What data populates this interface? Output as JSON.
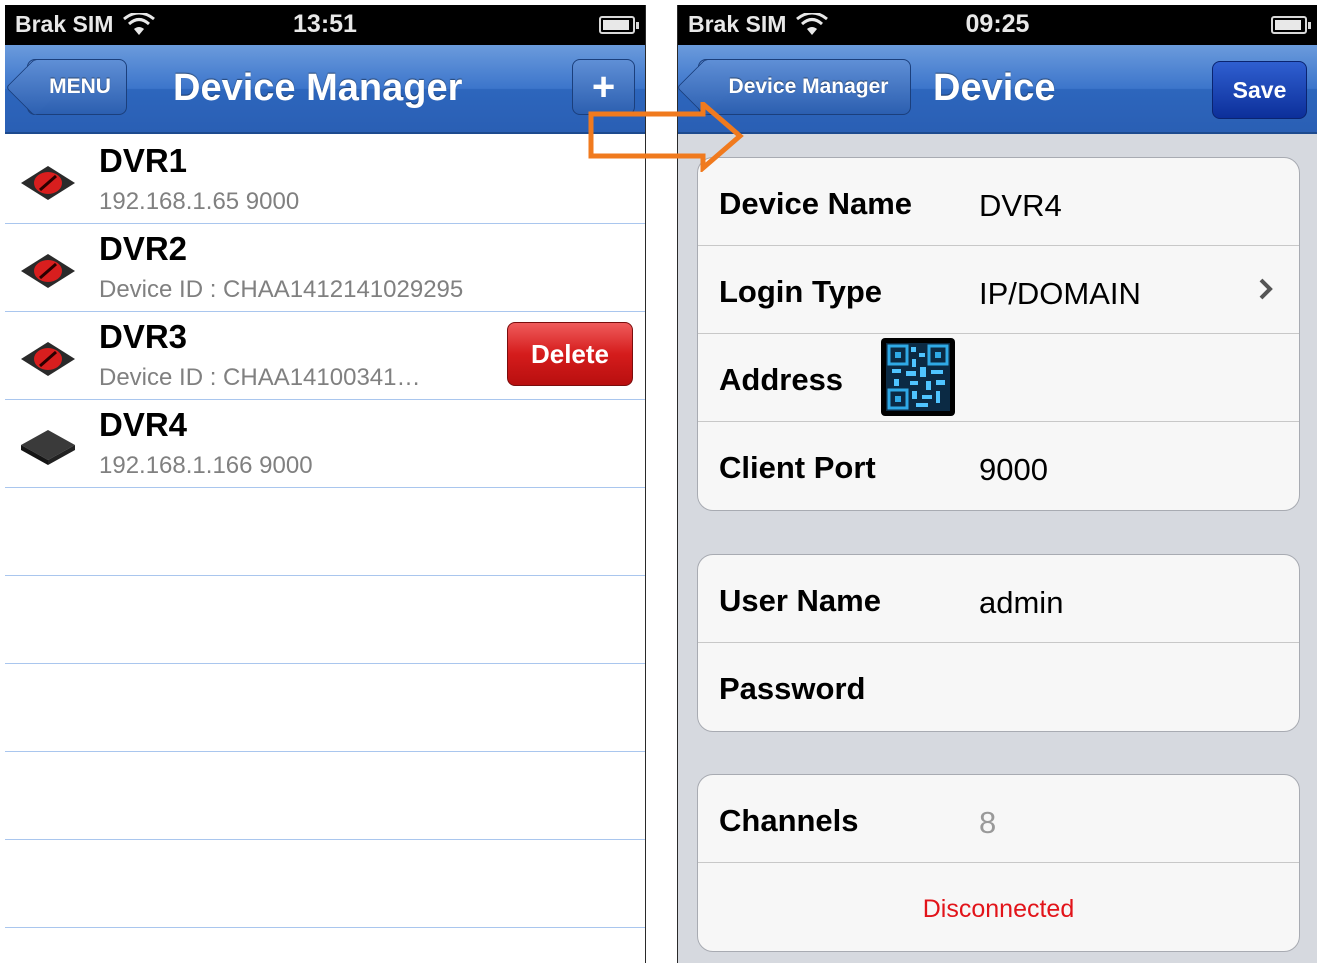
{
  "left_screen": {
    "status": {
      "carrier": "Brak SIM",
      "time": "13:51"
    },
    "nav": {
      "back_label": "MENU",
      "title": "Device Manager",
      "add_label": "+"
    },
    "devices": [
      {
        "name": "DVR1",
        "detail": "192.168.1.65  9000",
        "icon": "dvr-offline-icon"
      },
      {
        "name": "DVR2",
        "detail": "Device ID : CHAA1412141029295",
        "icon": "dvr-offline-icon"
      },
      {
        "name": "DVR3",
        "detail": "Device ID : CHAA14100341…",
        "icon": "dvr-offline-icon",
        "delete_label": "Delete"
      },
      {
        "name": "DVR4",
        "detail": "192.168.1.166  9000",
        "icon": "dvr-online-icon"
      }
    ]
  },
  "right_screen": {
    "status": {
      "carrier": "Brak SIM",
      "time": "09:25"
    },
    "nav": {
      "back_label": "Device Manager",
      "title": "Device",
      "save_label": "Save"
    },
    "group1": {
      "device_name_label": "Device Name",
      "device_name_value": "DVR4",
      "login_type_label": "Login Type",
      "login_type_value": "IP/DOMAIN",
      "address_label": "Address",
      "address_value": "",
      "client_port_label": "Client Port",
      "client_port_value": "9000"
    },
    "group2": {
      "user_name_label": "User Name",
      "user_name_value": "admin",
      "password_label": "Password",
      "password_value": ""
    },
    "group3": {
      "channels_label": "Channels",
      "channels_value": "8",
      "status_text": "Disconnected"
    }
  },
  "colors": {
    "nav_blue": "#3c75cb",
    "delete_red": "#d51c1c",
    "status_red": "#e2141a",
    "arrow_orange": "#f07a1e"
  }
}
